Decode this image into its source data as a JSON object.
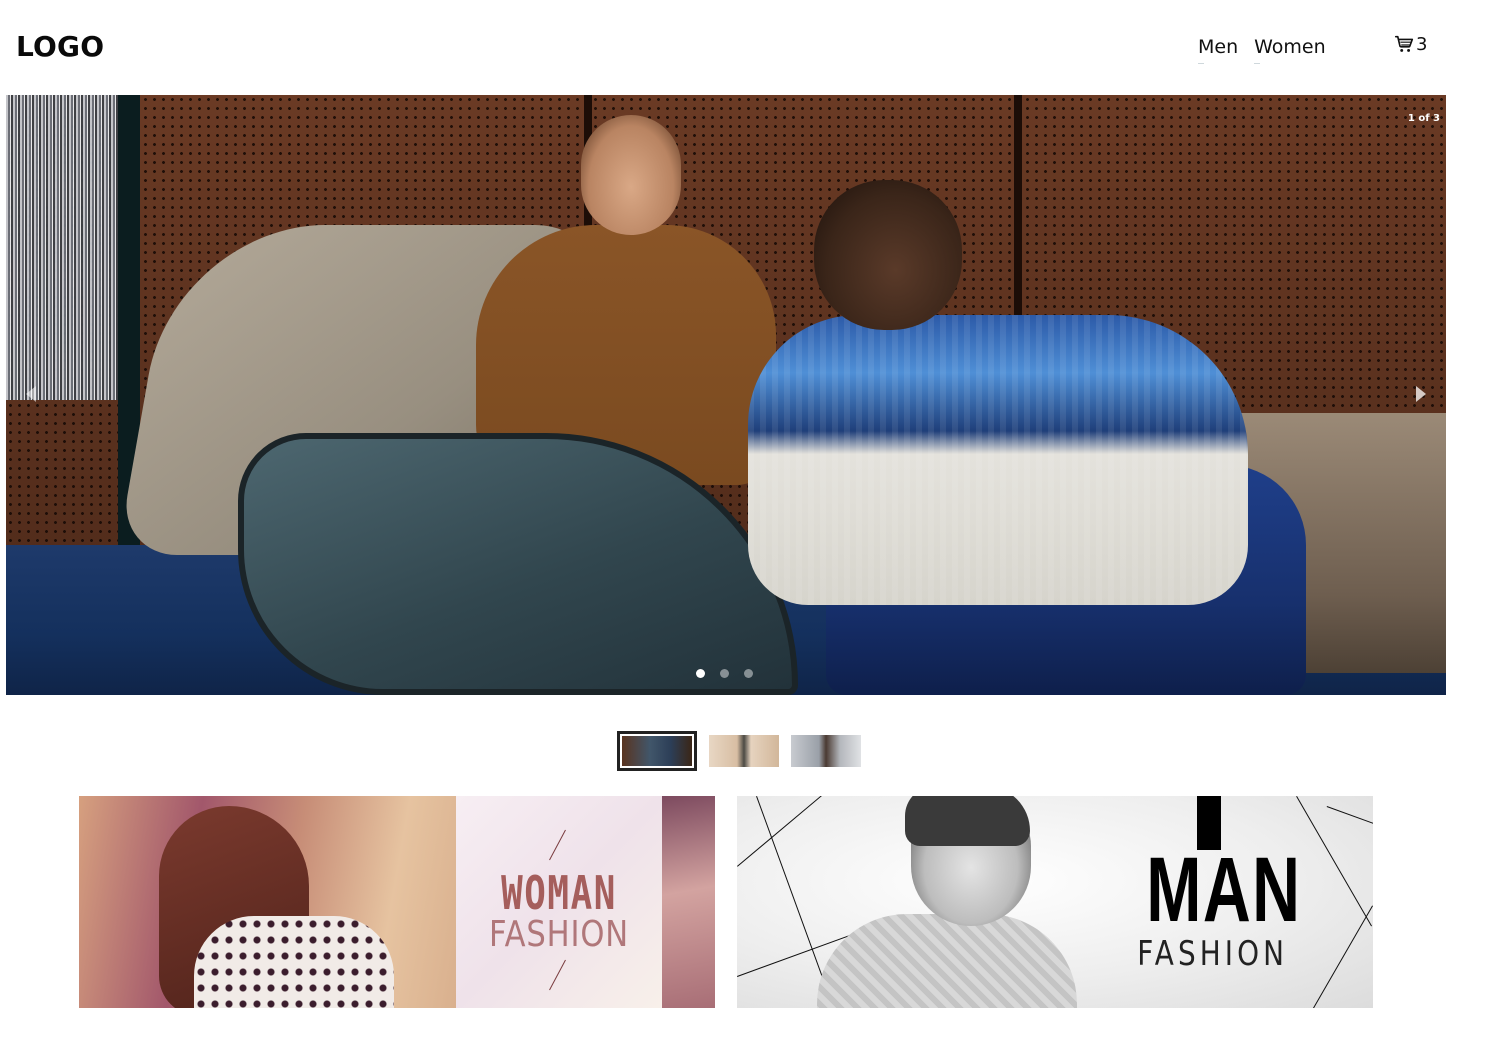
{
  "header": {
    "logo": "LOGO",
    "nav": [
      {
        "label": "Men"
      },
      {
        "label": "Women"
      }
    ],
    "cart": {
      "icon": "cart-icon",
      "count": "3"
    }
  },
  "carousel": {
    "counter": "1 of 3",
    "active_slide": 1,
    "slide_count": 3,
    "prev_icon": "chevron-left-icon",
    "next_icon": "chevron-right-icon"
  },
  "banners": {
    "woman": {
      "title": "WOMAN",
      "subtitle": "FASHION"
    },
    "man": {
      "title": "MAN",
      "subtitle": "FASHION"
    }
  }
}
